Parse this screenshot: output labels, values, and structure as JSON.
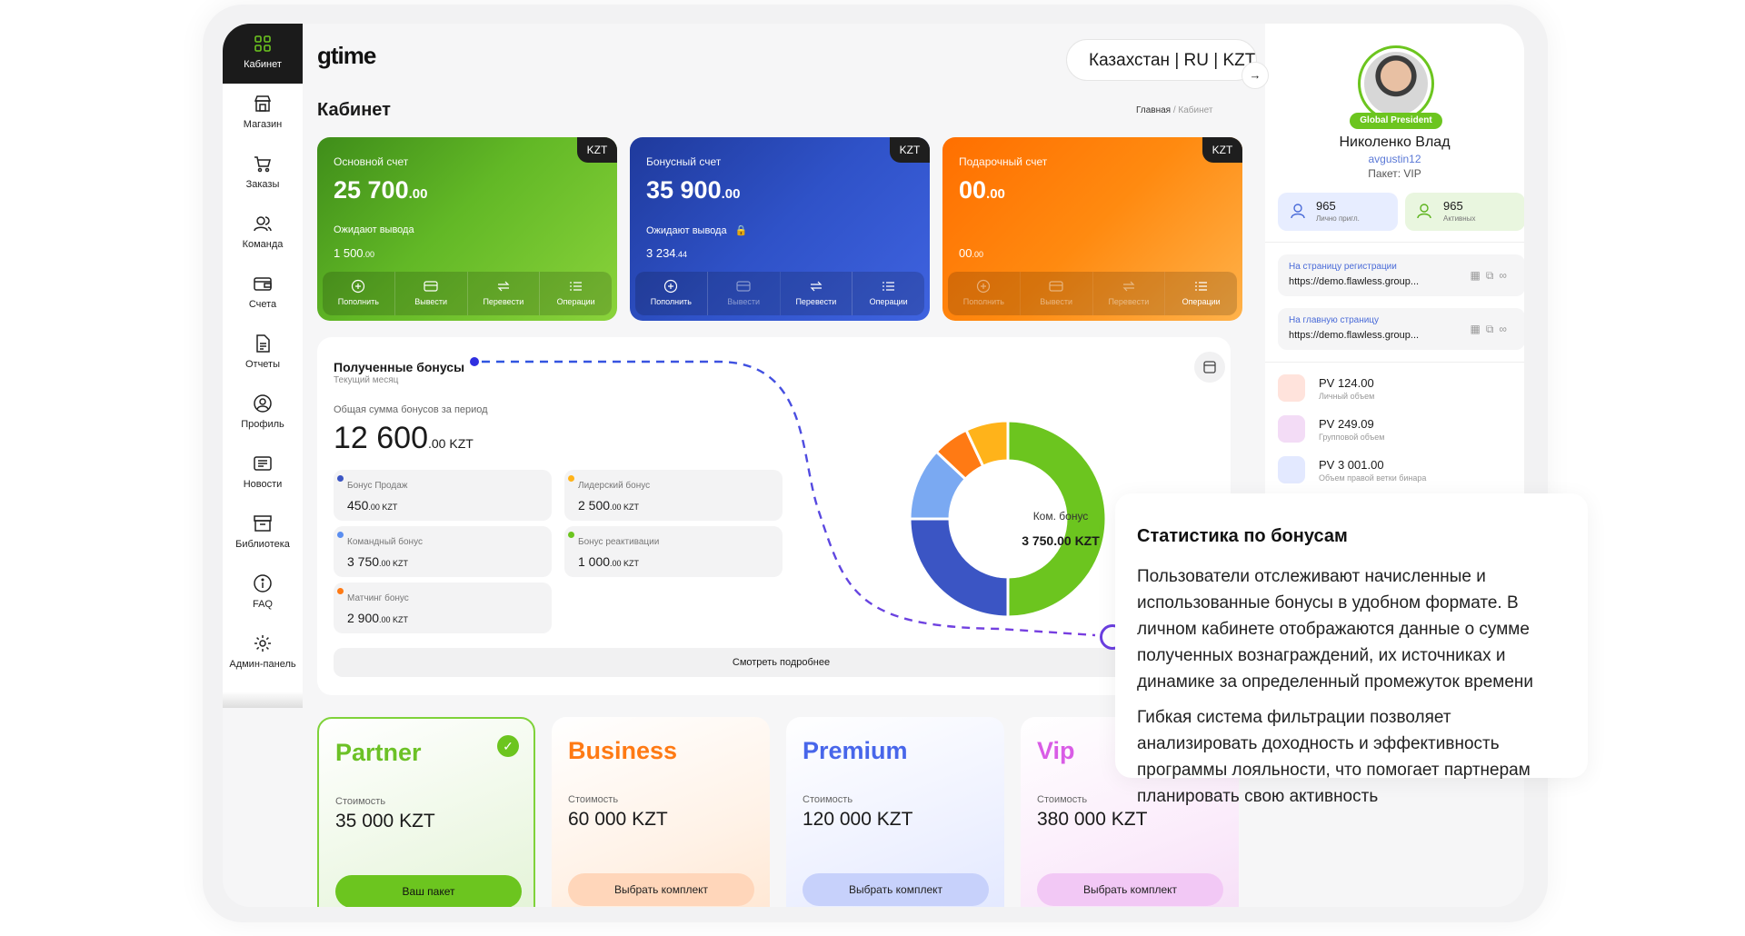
{
  "sidebar": {
    "items": [
      {
        "label": "Кабинет",
        "icon": "grid-icon",
        "active": true
      },
      {
        "label": "Магазин",
        "icon": "shop-icon"
      },
      {
        "label": "Заказы",
        "icon": "cart-icon"
      },
      {
        "label": "Команда",
        "icon": "team-icon"
      },
      {
        "label": "Счета",
        "icon": "wallet-icon"
      },
      {
        "label": "Отчеты",
        "icon": "report-icon"
      },
      {
        "label": "Профиль",
        "icon": "profile-icon"
      },
      {
        "label": "Новости",
        "icon": "news-icon"
      },
      {
        "label": "Библиотека",
        "icon": "library-icon"
      },
      {
        "label": "FAQ",
        "icon": "info-icon"
      },
      {
        "label": "Админ-панель",
        "icon": "gear-icon"
      }
    ]
  },
  "header": {
    "logo": "gtime",
    "language": "Казахстан | RU | KZT",
    "page_title": "Кабинет",
    "breadcrumb": {
      "home": "Главная",
      "sep": "/",
      "current": "Кабинет"
    }
  },
  "accounts": [
    {
      "title": "Основной счет",
      "amount": "25 700",
      "cents": ".00",
      "currency": "KZT",
      "pending_label": "Ожидают вывода",
      "pending": "1 500",
      "pending_cents": ".00",
      "color": "#5fb526"
    },
    {
      "title": "Бонусный счет",
      "amount": "35 900",
      "cents": ".00",
      "currency": "KZT",
      "pending_label": "Ожидают вывода",
      "pending": "3 234",
      "pending_cents": ".44",
      "color": "#2f52c8"
    },
    {
      "title": "Подарочный счет",
      "amount": "00",
      "cents": ".00",
      "currency": "KZT",
      "pending_label": "",
      "pending": "00",
      "pending_cents": ".00",
      "color": "#ff8a10"
    }
  ],
  "account_ops": [
    "Пополнить",
    "Вывести",
    "Перевести",
    "Операции"
  ],
  "bonuses": {
    "title": "Полученные бонусы",
    "subtitle": "Текущий месяц",
    "total_label": "Общая сумма бонусов за период",
    "total": "12 600",
    "total_cents": ".00 KZT",
    "items": [
      {
        "label": "Бонус Продаж",
        "value": "450",
        "cents": ".00 KZT",
        "color": "#3b55c4"
      },
      {
        "label": "Лидерский бонус",
        "value": "2 500",
        "cents": ".00 KZT",
        "color": "#ffb31a"
      },
      {
        "label": "Командный бонус",
        "value": "3 750",
        "cents": ".00 KZT",
        "color": "#5b8ef0"
      },
      {
        "label": "Бонус реактивации",
        "value": "1 000",
        "cents": ".00 KZT",
        "color": "#6cc51f"
      },
      {
        "label": "Матчинг бонус",
        "value": "2 900",
        "cents": ".00 KZT",
        "color": "#ff7a14"
      }
    ],
    "more_button": "Смотреть подробнее",
    "donut_label": "Ком. бонус",
    "donut_value": "3 750.00 KZT"
  },
  "chart_data": {
    "type": "pie",
    "title": "",
    "slices": [
      {
        "value": 50,
        "color": "#6cc51f"
      },
      {
        "value": 25,
        "color": "#3b55c4"
      },
      {
        "value": 12,
        "color": "#7aa9f2"
      },
      {
        "value": 6,
        "color": "#ff7a14"
      },
      {
        "value": 7,
        "color": "#ffb31a"
      }
    ]
  },
  "packages": [
    {
      "name": "Partner",
      "price_label": "Стоимость",
      "price": "35 000 KZT",
      "button": "Ваш пакет",
      "selected": true
    },
    {
      "name": "Business",
      "price_label": "Стоимость",
      "price": "60 000 KZT",
      "button": "Выбрать комплект"
    },
    {
      "name": "Premium",
      "price_label": "Стоимость",
      "price": "120 000 KZT",
      "button": "Выбрать комплект"
    },
    {
      "name": "Vip",
      "price_label": "Стоимость",
      "price": "380 000 KZT",
      "button": "Выбрать комплект"
    }
  ],
  "profile": {
    "badge": "Global President",
    "name": "Николенко Влад",
    "login": "avgustin12",
    "package": "Пакет: VIP",
    "counters": [
      {
        "value": "965",
        "label": "Лично пригл."
      },
      {
        "value": "965",
        "label": "Активных"
      }
    ],
    "links": [
      {
        "label": "На страницу регистрации",
        "url": "https://demo.flawless.group..."
      },
      {
        "label": "На главную страницу",
        "url": "https://demo.flawless.group..."
      }
    ],
    "volumes": [
      {
        "value": "PV 124.00",
        "label": "Личный объем",
        "color": "#ffe3dc"
      },
      {
        "value": "PV 249.09",
        "label": "Групповой объем",
        "color": "#f3dcf6"
      },
      {
        "value": "PV 3 001.00",
        "label": "Объем правой ветки бинара",
        "color": "#e3e9ff"
      }
    ]
  },
  "overlay": {
    "title": "Статистика по бонусам",
    "p1": "Пользователи отслеживают начисленные и использованные бонусы в удобном формате. В личном кабинете отображаются данные о сумме полученных вознаграждений, их источниках и динамике за определенный промежуток времени",
    "p2": "Гибкая система фильтрации позволяет анализировать доходность и эффективность программы лояльности, что помогает партнерам планировать свою активность"
  }
}
